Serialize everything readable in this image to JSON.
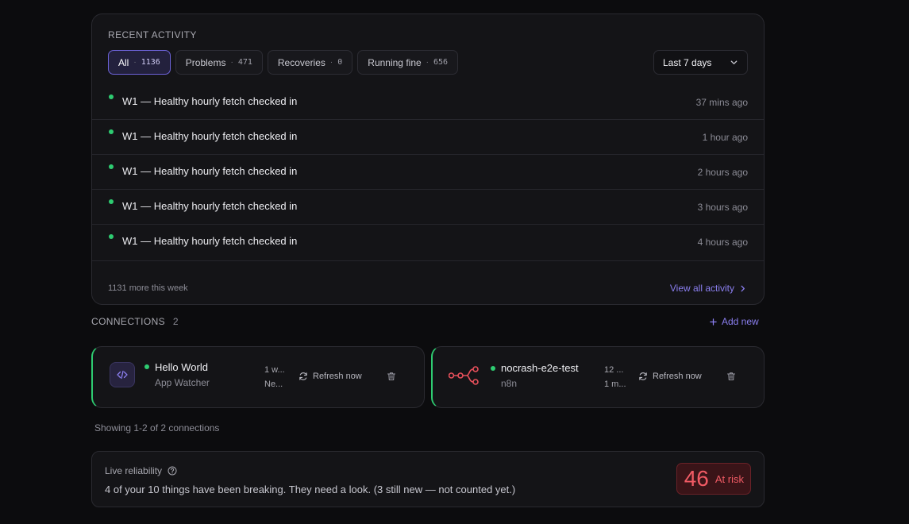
{
  "activity": {
    "title": "RECENT ACTIVITY",
    "filters": [
      {
        "label": "All",
        "count": "1136",
        "active": true
      },
      {
        "label": "Problems",
        "count": "471",
        "active": false
      },
      {
        "label": "Recoveries",
        "count": "0",
        "active": false
      },
      {
        "label": "Running fine",
        "count": "656",
        "active": false
      }
    ],
    "range": "Last 7 days",
    "items": [
      {
        "text": "W1 — Healthy hourly fetch checked in",
        "time": "37 mins ago"
      },
      {
        "text": "W1 — Healthy hourly fetch checked in",
        "time": "1 hour ago"
      },
      {
        "text": "W1 — Healthy hourly fetch checked in",
        "time": "2 hours ago"
      },
      {
        "text": "W1 — Healthy hourly fetch checked in",
        "time": "3 hours ago"
      },
      {
        "text": "W1 — Healthy hourly fetch checked in",
        "time": "4 hours ago"
      }
    ],
    "more_text": "1131 more this week",
    "view_all": "View all activity"
  },
  "connections": {
    "title": "CONNECTIONS",
    "count": "2",
    "add_new": "Add new",
    "items": [
      {
        "name": "Hello World",
        "type": "App Watcher",
        "meta1": "1 w...",
        "meta2": "Ne...",
        "refresh": "Refresh now",
        "icon": "code-icon"
      },
      {
        "name": "nocrash-e2e-test",
        "type": "n8n",
        "meta1": "12 ...",
        "meta2": "1 m...",
        "refresh": "Refresh now",
        "icon": "n8n-icon"
      }
    ],
    "showing": "Showing 1-2 of 2 connections"
  },
  "reliability": {
    "title": "Live reliability",
    "message": "4 of your 10 things have been breaking. They need a look. (3 still new — not counted yet.)",
    "score": "46",
    "status": "At risk"
  },
  "colors": {
    "accent": "#8b7ff0",
    "ok": "#2ecc71",
    "risk": "#f05a64"
  }
}
